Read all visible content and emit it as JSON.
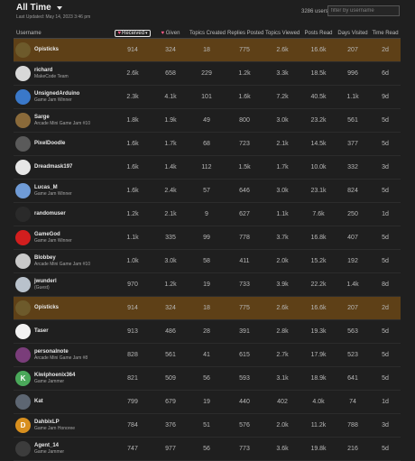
{
  "header": {
    "period_label": "All Time",
    "last_updated": "Last Updated: May 14, 2023 3:46 pm",
    "users_count": "3286 users",
    "filter_placeholder": "filter by username"
  },
  "columns": {
    "username": "Username",
    "received": "Received",
    "given": "Given",
    "topics_created": "Topics Created",
    "replies_posted": "Replies Posted",
    "topics_viewed": "Topics Viewed",
    "posts_read": "Posts Read",
    "days_visited": "Days Visited",
    "time_read": "Time Read"
  },
  "rows": [
    {
      "name": "Opisticks",
      "title": "",
      "received": "914",
      "given": "324",
      "topics_created": "18",
      "replies": "775",
      "topics_viewed": "2.6k",
      "posts_read": "16.6k",
      "days": "207",
      "time": "2d",
      "avatar": "avatar-opisticks",
      "highlight": true,
      "avatar_color": "#6d5a2b",
      "initial": ""
    },
    {
      "name": "richard",
      "title": "MakeCode Team",
      "received": "2.6k",
      "given": "658",
      "topics_created": "229",
      "replies": "1.2k",
      "topics_viewed": "3.3k",
      "posts_read": "18.5k",
      "days": "996",
      "time": "6d",
      "avatar": "avatar-richard",
      "highlight": false,
      "avatar_color": "#d8d8d8",
      "initial": ""
    },
    {
      "name": "UnsignedArduino",
      "title": "Game Jam Winner",
      "received": "2.3k",
      "given": "4.1k",
      "topics_created": "101",
      "replies": "1.6k",
      "topics_viewed": "7.2k",
      "posts_read": "40.5k",
      "days": "1.1k",
      "time": "9d",
      "avatar": "avatar-unsigned",
      "highlight": false,
      "avatar_color": "#3a78c9",
      "initial": ""
    },
    {
      "name": "Sarge",
      "title": "Arcade Mini Game Jam #10",
      "received": "1.8k",
      "given": "1.9k",
      "topics_created": "49",
      "replies": "800",
      "topics_viewed": "3.0k",
      "posts_read": "23.2k",
      "days": "561",
      "time": "5d",
      "avatar": "avatar-sarge",
      "highlight": false,
      "avatar_color": "#8a6a3a",
      "initial": ""
    },
    {
      "name": "PixelDoodle",
      "title": "",
      "received": "1.6k",
      "given": "1.7k",
      "topics_created": "68",
      "replies": "723",
      "topics_viewed": "2.1k",
      "posts_read": "14.5k",
      "days": "377",
      "time": "5d",
      "avatar": "avatar-pixeldoodle",
      "highlight": false,
      "avatar_color": "#5a5a5a",
      "initial": ""
    },
    {
      "name": "Dreadmask197",
      "title": "",
      "received": "1.6k",
      "given": "1.4k",
      "topics_created": "112",
      "replies": "1.5k",
      "topics_viewed": "1.7k",
      "posts_read": "10.0k",
      "days": "332",
      "time": "3d",
      "avatar": "avatar-dreadmask",
      "highlight": false,
      "avatar_color": "#e6e6e6",
      "initial": ""
    },
    {
      "name": "Lucas_M",
      "title": "Game Jam Winner",
      "received": "1.6k",
      "given": "2.4k",
      "topics_created": "57",
      "replies": "646",
      "topics_viewed": "3.0k",
      "posts_read": "23.1k",
      "days": "824",
      "time": "5d",
      "avatar": "avatar-lucas",
      "highlight": false,
      "avatar_color": "#6f9bd6",
      "initial": ""
    },
    {
      "name": "randomuser",
      "title": "",
      "received": "1.2k",
      "given": "2.1k",
      "topics_created": "9",
      "replies": "627",
      "topics_viewed": "1.1k",
      "posts_read": "7.6k",
      "days": "250",
      "time": "1d",
      "avatar": "avatar-randomuser",
      "highlight": false,
      "avatar_color": "#2a2a2a",
      "initial": ""
    },
    {
      "name": "GameGod",
      "title": "Game Jam Winner",
      "received": "1.1k",
      "given": "335",
      "topics_created": "99",
      "replies": "778",
      "topics_viewed": "3.7k",
      "posts_read": "16.8k",
      "days": "407",
      "time": "5d",
      "avatar": "avatar-gamegod",
      "highlight": false,
      "avatar_color": "#d21e1e",
      "initial": ""
    },
    {
      "name": "Blobbey",
      "title": "Arcade Mini Game Jam #10",
      "received": "1.0k",
      "given": "3.0k",
      "topics_created": "58",
      "replies": "411",
      "topics_viewed": "2.0k",
      "posts_read": "15.2k",
      "days": "192",
      "time": "5d",
      "avatar": "avatar-blobbey",
      "highlight": false,
      "avatar_color": "#c9c9c9",
      "initial": ""
    },
    {
      "name": "jwunderl",
      "title": "(Guest)",
      "received": "970",
      "given": "1.2k",
      "topics_created": "19",
      "replies": "733",
      "topics_viewed": "3.9k",
      "posts_read": "22.2k",
      "days": "1.4k",
      "time": "8d",
      "avatar": "avatar-jwunderl",
      "highlight": false,
      "avatar_color": "#b9c2cc",
      "initial": ""
    },
    {
      "name": "Opisticks",
      "title": "",
      "received": "914",
      "given": "324",
      "topics_created": "18",
      "replies": "775",
      "topics_viewed": "2.6k",
      "posts_read": "16.6k",
      "days": "207",
      "time": "2d",
      "avatar": "avatar-opisticks",
      "highlight": true,
      "avatar_color": "#6d5a2b",
      "initial": ""
    },
    {
      "name": "Taser",
      "title": "",
      "received": "913",
      "given": "486",
      "topics_created": "28",
      "replies": "391",
      "topics_viewed": "2.8k",
      "posts_read": "19.3k",
      "days": "563",
      "time": "5d",
      "avatar": "avatar-taser",
      "highlight": false,
      "avatar_color": "#f2f2f2",
      "initial": ""
    },
    {
      "name": "personalnote",
      "title": "Arcade Mini Game Jam #8",
      "received": "828",
      "given": "561",
      "topics_created": "41",
      "replies": "615",
      "topics_viewed": "2.7k",
      "posts_read": "17.9k",
      "days": "523",
      "time": "5d",
      "avatar": "avatar-personalnote",
      "highlight": false,
      "avatar_color": "#7a3d7a",
      "initial": ""
    },
    {
      "name": "Kiwiphoenix364",
      "title": "Game Jammer",
      "received": "821",
      "given": "509",
      "topics_created": "56",
      "replies": "593",
      "topics_viewed": "3.1k",
      "posts_read": "18.9k",
      "days": "641",
      "time": "5d",
      "avatar": "avatar-kiwi",
      "highlight": false,
      "avatar_color": "#4aa85a",
      "initial": "K"
    },
    {
      "name": "Kat",
      "title": "",
      "received": "799",
      "given": "679",
      "topics_created": "19",
      "replies": "440",
      "topics_viewed": "402",
      "posts_read": "4.0k",
      "days": "74",
      "time": "1d",
      "avatar": "avatar-kat",
      "highlight": false,
      "avatar_color": "#5d6672",
      "initial": ""
    },
    {
      "name": "DahbixLP",
      "title": "Game Jam Honoree",
      "received": "784",
      "given": "376",
      "topics_created": "51",
      "replies": "576",
      "topics_viewed": "2.0k",
      "posts_read": "11.2k",
      "days": "788",
      "time": "3d",
      "avatar": "avatar-dahbix",
      "highlight": false,
      "avatar_color": "#d88f1e",
      "initial": "D"
    },
    {
      "name": "Agent_14",
      "title": "Game Jammer",
      "received": "747",
      "given": "977",
      "topics_created": "56",
      "replies": "773",
      "topics_viewed": "3.6k",
      "posts_read": "19.8k",
      "days": "216",
      "time": "5d",
      "avatar": "avatar-agent14",
      "highlight": false,
      "avatar_color": "#3c3c3c",
      "initial": ""
    }
  ]
}
